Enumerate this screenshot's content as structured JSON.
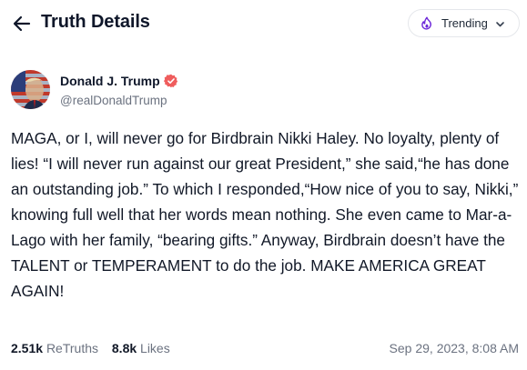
{
  "header": {
    "title": "Truth Details",
    "back_icon": "arrow-left-icon",
    "feed_selector": {
      "label": "Trending",
      "icon": "flame-icon",
      "chevron": "chevron-down-icon",
      "accent_color": "#6d28d9"
    }
  },
  "post": {
    "author": {
      "display_name": "Donald J. Trump",
      "handle": "@realDonaldTrump",
      "verified": true,
      "verified_badge_color": "#ef5d5d"
    },
    "text": "MAGA, or I, will never go for Birdbrain Nikki Haley. No loyalty, plenty of lies! “I will never run against our great President,” she said,“he has done an outstanding job.” To which I responded,“How nice of you to say, Nikki,” knowing full well that her words mean nothing. She even came to Mar-a-Lago with her family, “bearing gifts.” Anyway, Birdbrain doesn’t have the TALENT or TEMPERAMENT to do the job. MAKE AMERICA GREAT AGAIN!",
    "stats": {
      "retruths_count": "2.51k",
      "retruths_label": "ReTruths",
      "likes_count": "8.8k",
      "likes_label": "Likes"
    },
    "timestamp": "Sep 29, 2023, 8:08 AM"
  }
}
